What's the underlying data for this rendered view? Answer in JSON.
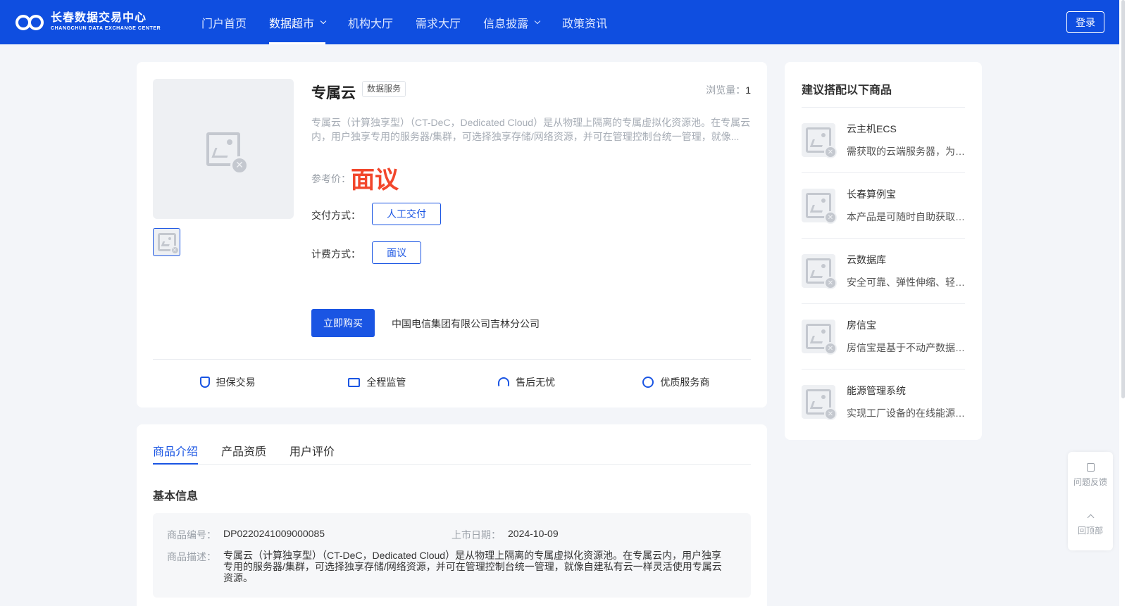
{
  "header": {
    "logo_cn": "长春数据交易中心",
    "logo_en": "CHANGCHUN DATA EXCHANGE CENTER",
    "nav": [
      {
        "label": "门户首页",
        "active": false,
        "has_dropdown": false
      },
      {
        "label": "数据超市",
        "active": true,
        "has_dropdown": true
      },
      {
        "label": "机构大厅",
        "active": false,
        "has_dropdown": false
      },
      {
        "label": "需求大厅",
        "active": false,
        "has_dropdown": false
      },
      {
        "label": "信息披露",
        "active": false,
        "has_dropdown": true
      },
      {
        "label": "政策资讯",
        "active": false,
        "has_dropdown": false
      }
    ],
    "login_label": "登录"
  },
  "product": {
    "title": "专属云",
    "tag": "数据服务",
    "views_label": "浏览量：",
    "views_value": "1",
    "description": "专属云（计算独享型）（CT-DeC，Dedicated Cloud）是从物理上隔离的专属虚拟化资源池。在专属云内，用户独享专用的服务器/集群，可选择独享存储/网络资源，并可在管理控制台统一管理，就像...",
    "price_label": "参考价：",
    "price": "面议",
    "delivery_label": "交付方式：",
    "delivery_option": "人工交付",
    "billing_label": "计费方式：",
    "billing_option": "面议",
    "buy_label": "立即购买",
    "vendor": "中国电信集团有限公司吉林分公司",
    "features": [
      {
        "icon": "shield-icon",
        "label": "担保交易"
      },
      {
        "icon": "monitor-icon",
        "label": "全程监管"
      },
      {
        "icon": "headset-icon",
        "label": "售后无忧"
      },
      {
        "icon": "heart-badge-icon",
        "label": "优质服务商"
      }
    ]
  },
  "recommendations": {
    "title": "建议搭配以下商品",
    "items": [
      {
        "name": "云主机ECS",
        "desc": "需获取的云端服务器，为用户提供弹性计算服务"
      },
      {
        "name": "长春算例宝",
        "desc": "本产品是可随时自助获取的算力服务"
      },
      {
        "name": "云数据库",
        "desc": "安全可靠、弹性伸缩、轻松运维的数据库服务"
      },
      {
        "name": "房信宝",
        "desc": "房信宝是基于不动产数据的信息服务"
      },
      {
        "name": "能源管理系统",
        "desc": "实现工厂设备的在线能源管理"
      }
    ]
  },
  "details": {
    "tabs": [
      {
        "label": "商品介绍",
        "active": true
      },
      {
        "label": "产品资质",
        "active": false
      },
      {
        "label": "用户评价",
        "active": false
      }
    ],
    "section_title": "基本信息",
    "code_label": "商品编号：",
    "code_value": "DP0220241009000085",
    "date_label": "上市日期：",
    "date_value": "2024-10-09",
    "desc_label": "商品描述：",
    "desc_value": "专属云（计算独享型）（CT-DeC，Dedicated Cloud）是从物理上隔离的专属虚拟化资源池。在专属云内，用户独享专用的服务器/集群，可选择独享存储/网络资源，并可在管理控制台统一管理，就像自建私有云一样灵活使用专属云资源。"
  },
  "float_tools": {
    "feedback_label": "问题反馈",
    "top_label": "回顶部"
  },
  "colors": {
    "brand": "#0f4ee0",
    "accent": "#1a55e3",
    "price": "#f2472c"
  }
}
